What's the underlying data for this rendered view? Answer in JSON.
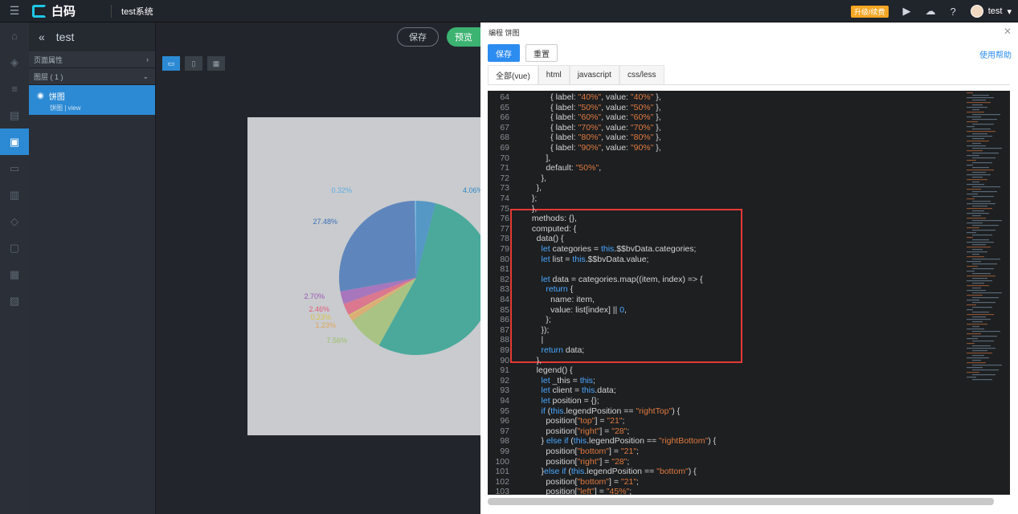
{
  "topbar": {
    "brand": "白码",
    "system_name": "test系统",
    "upgrade_badge": "升级/续费",
    "user": "test"
  },
  "panel": {
    "page_title": "test",
    "page_props": "页面属性",
    "layers_title": "图层 ( 1 )",
    "layer_name": "饼图",
    "layer_tags": "饼图 | view"
  },
  "canvas": {
    "save": "保存",
    "preview": "预览"
  },
  "modal": {
    "title": "编程 饼图",
    "save": "保存",
    "reset": "重置",
    "help": "使用帮助",
    "tabs": [
      "全部(vue)",
      "html",
      "javascript",
      "css/less"
    ]
  },
  "colors": {
    "accent": "#2d8cf0",
    "nav_active": "#2c8ad4",
    "highlight_box": "#e53935"
  },
  "code": [
    [
      "64",
      "          { label: \"40%\", value: \"40%\" },"
    ],
    [
      "65",
      "          { label: \"50%\", value: \"50%\" },"
    ],
    [
      "66",
      "          { label: \"60%\", value: \"60%\" },"
    ],
    [
      "67",
      "          { label: \"70%\", value: \"70%\" },"
    ],
    [
      "68",
      "          { label: \"80%\", value: \"80%\" },"
    ],
    [
      "69",
      "          { label: \"90%\", value: \"90%\" },"
    ],
    [
      "70",
      "        ],"
    ],
    [
      "71",
      "        default: \"50%\","
    ],
    [
      "72",
      "      },"
    ],
    [
      "73",
      "    },"
    ],
    [
      "74",
      "  };"
    ],
    [
      "75",
      "  },"
    ],
    [
      "76",
      "  methods: {},"
    ],
    [
      "77",
      "  computed: {"
    ],
    [
      "78",
      "    data() {"
    ],
    [
      "79",
      "      let categories = this.$$bvData.categories;"
    ],
    [
      "80",
      "      let list = this.$$bvData.value;"
    ],
    [
      "81",
      ""
    ],
    [
      "82",
      "      let data = categories.map((item, index) => {"
    ],
    [
      "83",
      "        return {"
    ],
    [
      "84",
      "          name: item,"
    ],
    [
      "85",
      "          value: list[index] || 0,"
    ],
    [
      "86",
      "        };"
    ],
    [
      "87",
      "      });"
    ],
    [
      "88",
      "      |"
    ],
    [
      "89",
      "      return data;"
    ],
    [
      "90",
      "    },"
    ],
    [
      "91",
      "    legend() {"
    ],
    [
      "92",
      "      let _this = this;"
    ],
    [
      "93",
      "      let client = this.data;"
    ],
    [
      "94",
      "      let position = {};"
    ],
    [
      "95",
      "      if (this.legendPosition == \"rightTop\") {"
    ],
    [
      "96",
      "        position[\"top\"] = \"21\";"
    ],
    [
      "97",
      "        position[\"right\"] = \"28\";"
    ],
    [
      "98",
      "      } else if (this.legendPosition == \"rightBottom\") {"
    ],
    [
      "99",
      "        position[\"bottom\"] = \"21\";"
    ],
    [
      "100",
      "        position[\"right\"] = \"28\";"
    ],
    [
      "101",
      "      }else if (this.legendPosition == \"bottom\") {"
    ],
    [
      "102",
      "        position[\"bottom\"] = \"21\";"
    ],
    [
      "103",
      "        position[\"left\"] = \"45%\";"
    ]
  ],
  "pie": {
    "labels": [
      "0.32%",
      "4.06%",
      "27.48%",
      "2.70%",
      "2.46%",
      "0.23%",
      "1.23%",
      "7.56%"
    ],
    "slices": [
      {
        "value": 4.06,
        "color": "#2e86c1"
      },
      {
        "value": 53.96,
        "color": "#1f9e8a"
      },
      {
        "value": 7.56,
        "color": "#9cc06a"
      },
      {
        "value": 1.23,
        "color": "#e0a458"
      },
      {
        "value": 0.23,
        "color": "#d9c24e"
      },
      {
        "value": 2.46,
        "color": "#e05c7a"
      },
      {
        "value": 2.7,
        "color": "#9b59b6"
      },
      {
        "value": 27.48,
        "color": "#3b6fb6"
      },
      {
        "value": 0.32,
        "color": "#5dade2"
      }
    ]
  }
}
